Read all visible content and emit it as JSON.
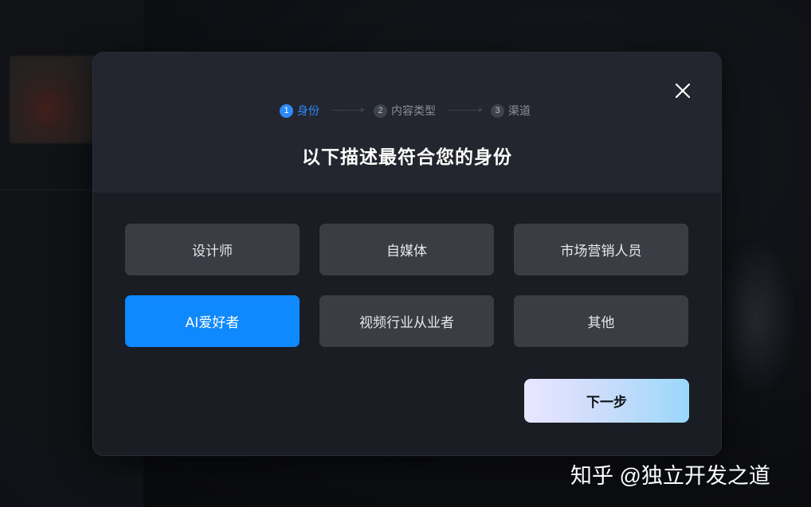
{
  "stepper": {
    "steps": [
      {
        "num": "1",
        "label": "身份"
      },
      {
        "num": "2",
        "label": "内容类型"
      },
      {
        "num": "3",
        "label": "渠道"
      }
    ]
  },
  "title": "以下描述最符合您的身份",
  "options": [
    {
      "label": "设计师"
    },
    {
      "label": "自媒体"
    },
    {
      "label": "市场营销人员"
    },
    {
      "label": "AI爱好者"
    },
    {
      "label": "视频行业从业者"
    },
    {
      "label": "其他"
    }
  ],
  "next_label": "下一步",
  "watermark": "知乎 @独立开发之道",
  "colors": {
    "accent": "#0f89ff",
    "modal_bg": "#1b1d24",
    "option_bg": "#3a3d44"
  }
}
